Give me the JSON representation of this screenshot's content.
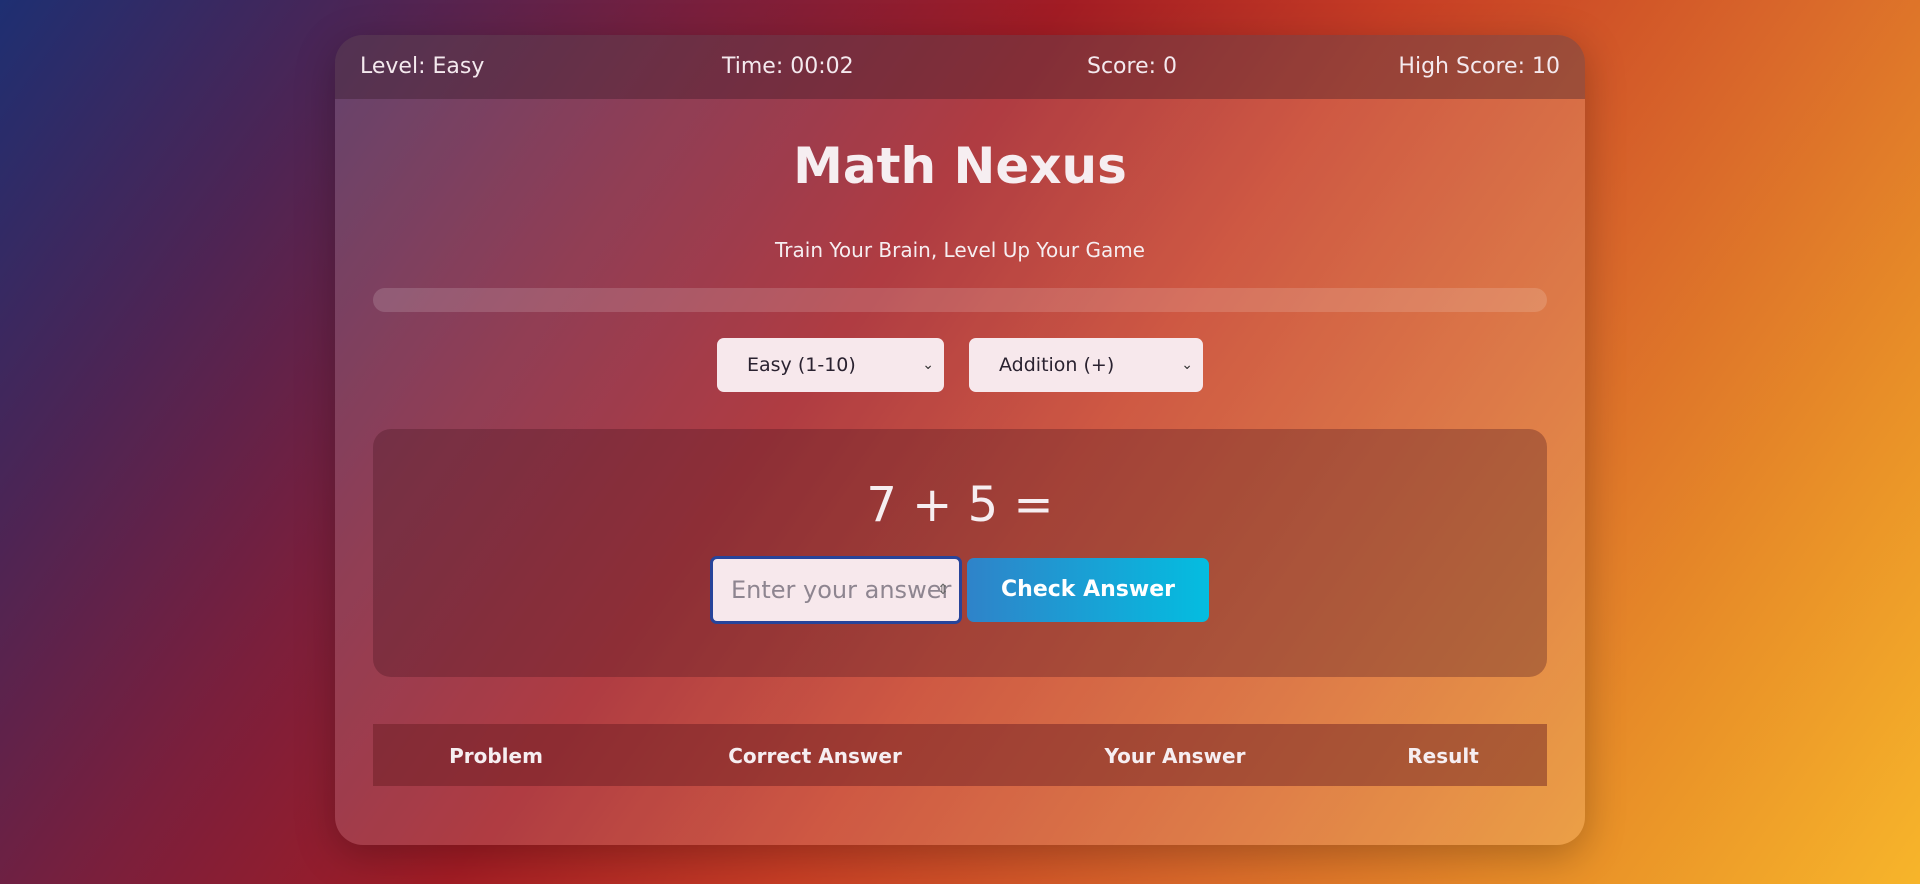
{
  "status_bar": {
    "level": "Level: Easy",
    "time": "Time: 00:02",
    "score": "Score: 0",
    "high_score": "High Score: 10"
  },
  "header": {
    "title": "Math Nexus",
    "subtitle": "Train Your Brain, Level Up Your Game"
  },
  "progress": {
    "value": 0.0
  },
  "controls": {
    "difficulty": {
      "selected": "Easy (1-10)"
    },
    "operation": {
      "selected": "Addition (+)"
    }
  },
  "problem": {
    "text": "7 + 5 =",
    "answer_placeholder": "Enter your answer",
    "check_label": "Check Answer"
  },
  "history": {
    "columns": [
      "Problem",
      "Correct Answer",
      "Your Answer",
      "Result"
    ]
  },
  "icons": {
    "select_chevron": "chevron-down-icon",
    "number_spinner": "spinner-icon"
  }
}
